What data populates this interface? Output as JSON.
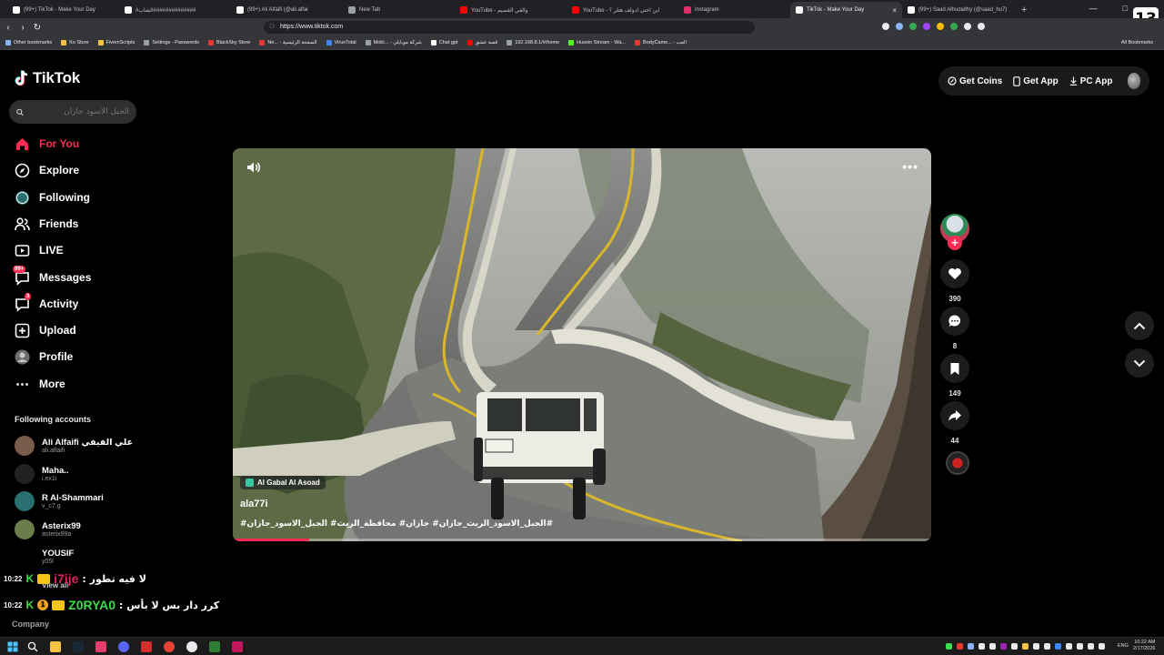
{
  "browser": {
    "tabs": [
      {
        "title": "(99+) TikTok - Make Your Day",
        "icon_color": "#ffffff",
        "active": false
      },
      {
        "title": "#الشاب##############",
        "icon_color": "#ffffff",
        "active": false
      },
      {
        "title": "(99+) Ali Alfaifi (@ali.alfai",
        "icon_color": "#ffffff",
        "active": false
      },
      {
        "title": "New Tab",
        "icon_color": "#9aa0a6",
        "active": false
      },
      {
        "title": "YouTube - والقي القصيم",
        "icon_color": "#ff0000",
        "active": false
      },
      {
        "title": "YouTube - ابن اختي ادولف هتلر ؟",
        "icon_color": "#ff0000",
        "active": false
      },
      {
        "title": "Instagram",
        "icon_color": "#e1306c",
        "active": false
      },
      {
        "title": "TikTok - Make Your Day",
        "icon_color": "#ffffff",
        "active": true
      },
      {
        "title": "(99+) Saad Alhudaithy (@saad_hu7)",
        "icon_color": "#ffffff",
        "active": false
      }
    ],
    "new_tab_label": "+",
    "url": "https://www.tiktok.com",
    "bookmarks": [
      {
        "label": "Other bookmarks",
        "color": "#8ab4f8"
      },
      {
        "label": "Ko Store",
        "color": "#f6c343"
      },
      {
        "label": "FivemScripts",
        "color": "#f6c343"
      },
      {
        "label": "Settings - Passwords",
        "color": "#9aa0a6"
      },
      {
        "label": "BlackSky Store",
        "color": "#e53935"
      },
      {
        "label": "Ne... - الصفحة الرئيسية",
        "color": "#e53935"
      },
      {
        "label": "VirusTotal",
        "color": "#4285f4"
      },
      {
        "label": "Mobi... - شركة موبايلي",
        "color": "#9aa0a6"
      },
      {
        "label": "Chat gpt",
        "color": "#ffffff"
      },
      {
        "label": "قصة عشق",
        "color": "#ff0000"
      },
      {
        "label": "192.168.8.1/#/home",
        "color": "#9aa0a6"
      },
      {
        "label": "Husein Stream - Wa...",
        "color": "#53fc18"
      },
      {
        "label": "BodyCame... - العب",
        "color": "#e53935"
      }
    ],
    "all_bookmarks_label": "All Bookmarks",
    "corner_logo": "13"
  },
  "tiktok": {
    "wordmark": "TikTok",
    "search_placeholder": "الجبل الاسود جازان",
    "nav": [
      {
        "label": "For You",
        "icon": "home-icon",
        "active": true
      },
      {
        "label": "Explore",
        "icon": "compass-icon",
        "active": false
      },
      {
        "label": "Following",
        "icon": "following-icon",
        "active": false
      },
      {
        "label": "Friends",
        "icon": "friends-icon",
        "active": false
      },
      {
        "label": "LIVE",
        "icon": "live-icon",
        "active": false
      },
      {
        "label": "Messages",
        "icon": "messages-icon",
        "active": false,
        "badge": "99+"
      },
      {
        "label": "Activity",
        "icon": "activity-icon",
        "active": false,
        "badge": "3"
      },
      {
        "label": "Upload",
        "icon": "upload-icon",
        "active": false
      },
      {
        "label": "Profile",
        "icon": "profile-icon",
        "active": false
      },
      {
        "label": "More",
        "icon": "more-icon",
        "active": false
      }
    ],
    "following_title": "Following accounts",
    "following": [
      {
        "name": "Ali Alfaifi علي الفيفي",
        "handle": "ali.alfaifi",
        "color": "#7a5c4a"
      },
      {
        "name": "Maha..",
        "handle": "i.ex1i",
        "color": "#222222"
      },
      {
        "name": "R Al-Shammari",
        "handle": "v_c7.g",
        "color": "#2a6f6f"
      },
      {
        "name": "Asterix99",
        "handle": "asterix99a",
        "color": "#6b7d4a"
      },
      {
        "name": "YOUSIF",
        "handle": "y05l",
        "color": "#000000"
      }
    ],
    "view_all": "View all",
    "company": "Company",
    "header": {
      "get_coins": "Get Coins",
      "get_app": "Get App",
      "pc_app": "PC App"
    },
    "video": {
      "location": "Al Gabal Al Asoad",
      "author": "ala77i",
      "caption": "#الجبل_الاسود_الريث_جازان# جازان# محافظة_الريث# الجبل_الاسود_جازان#",
      "progress": 0.11
    },
    "actions": {
      "likes": "390",
      "comments": "8",
      "saves": "149",
      "shares": "44"
    }
  },
  "chat": [
    {
      "time": "10:22",
      "user": "i7ije",
      "user_color": "#e0245e",
      "message": "لا فيه تطور :"
    },
    {
      "time": "10:22",
      "user": "Z0RYA0",
      "user_color": "#3ddc4b",
      "message": "كرر دار بس لا بأس :"
    }
  ],
  "taskbar": {
    "lang": "ENG",
    "time": "10:22 AM",
    "date": "2/17/2026"
  }
}
